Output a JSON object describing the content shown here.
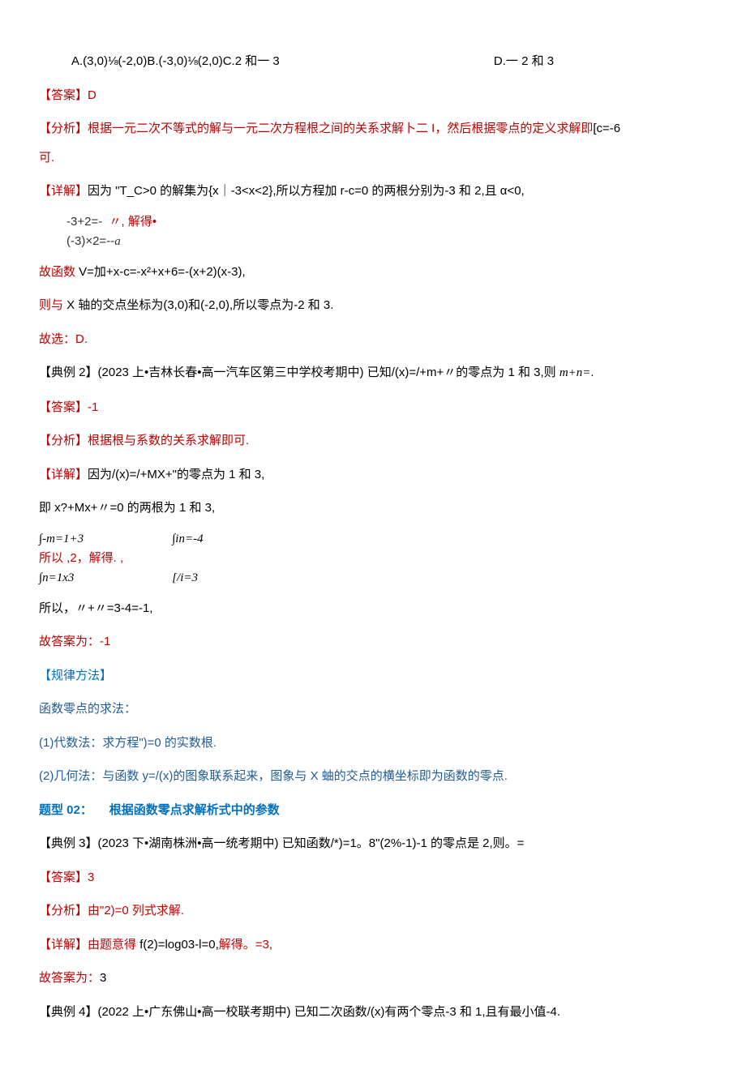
{
  "options": {
    "abc": "A.(3,0)⅛(-2,0)B.(-3,0)⅛(2,0)C.2 和一 3",
    "d": "D.一 2 和 3"
  },
  "ans1": "【答案】D",
  "analysis1_a": "【分析】根据一元二次不等式的解与一元二次方程根之间的关系求解卜二 I，然后根据零点的定义求解即",
  "analysis1_b": "[c=-6",
  "analysis1_c": "可.",
  "detail1_a": "【详解】",
  "detail1_b": "因为 \"T_C>0 的解集为{x｜-3<x<2},所以方程加 r-c=0 的两根分别为-3 和 2,且 α<0,",
  "block1_l1": "-3+2=-",
  "block1_mid": "〃, 解得•",
  "block1_l2": "(-3)×2=--",
  "block1_sub": "a",
  "line_func": "故函数 ",
  "line_func_b": "V=加+x-c=-x²+x+6=-(x+2)(x-3),",
  "line_xaxis_a": "则与 ",
  "line_xaxis_b": "X 轴的交点坐标为(3,0)和(-2,0),所以零点为-2 和 3.",
  "line_pick": "故选：D.",
  "ex2_a": "【典例 2】(2023 上•吉林长春•高一汽车区第三中学校考期中) 已知/(x)=/+m+〃的零点为 1 和 3,则 ",
  "ex2_b": "m+n=",
  "ex2_c": ".",
  "ans2": "【答案】-1",
  "analysis2": "【分析】根据根与系数的关系求解即可.",
  "detail2_a": "【详解】",
  "detail2_b": "因为/(x)=/+MX+\"的零点为 1 和 3,",
  "line_eq": "即 x?+Mx+〃=0 的两根为 1 和 3,",
  "tbl": {
    "c1a": "∫-m=1+3",
    "c1b": "∫n=1x3",
    "mid": "所以 ,2，解得. ,",
    "c2a": "∫in=-4",
    "c2b": "[/i=3"
  },
  "line_sum": "所以，〃+〃=3-4=-1,",
  "line_ans2": "故答案为：-1",
  "rule_h": "【规律方法】",
  "rule_t": "函数零点的求法：",
  "rule_1": "(1)代数法：求方程\")=0 的实数根.",
  "rule_2": "(2)几何法：与函数 y=/(x)的图象联系起来，图象与 X 蚰的交点的横坐标即为函数的零点.",
  "sec_a": "题型 02：",
  "sec_b": "根据函数零点求解析式中的参数",
  "ex3": "【典例 3】(2023 下•湖南株洲•高一统考期中) 已知函数/*)=1。8\"(2%-1)-1 的零点是 2,则。=",
  "ans3": "【答案】3",
  "analysis3": "【分析】由\"2)=0 列式求解.",
  "detail3_a": "【详解】",
  "detail3_b": "由题意得 ",
  "detail3_c": "f(2)=log03-l=0,",
  "detail3_d": "解得。=3,",
  "line_ans3_a": "故答案为：",
  "line_ans3_b": "3",
  "ex4": "【典例 4】(2022 上•广东佛山•高一校联考期中) 已知二次函数/(x)有两个零点-3 和 1,且有最小值-4."
}
